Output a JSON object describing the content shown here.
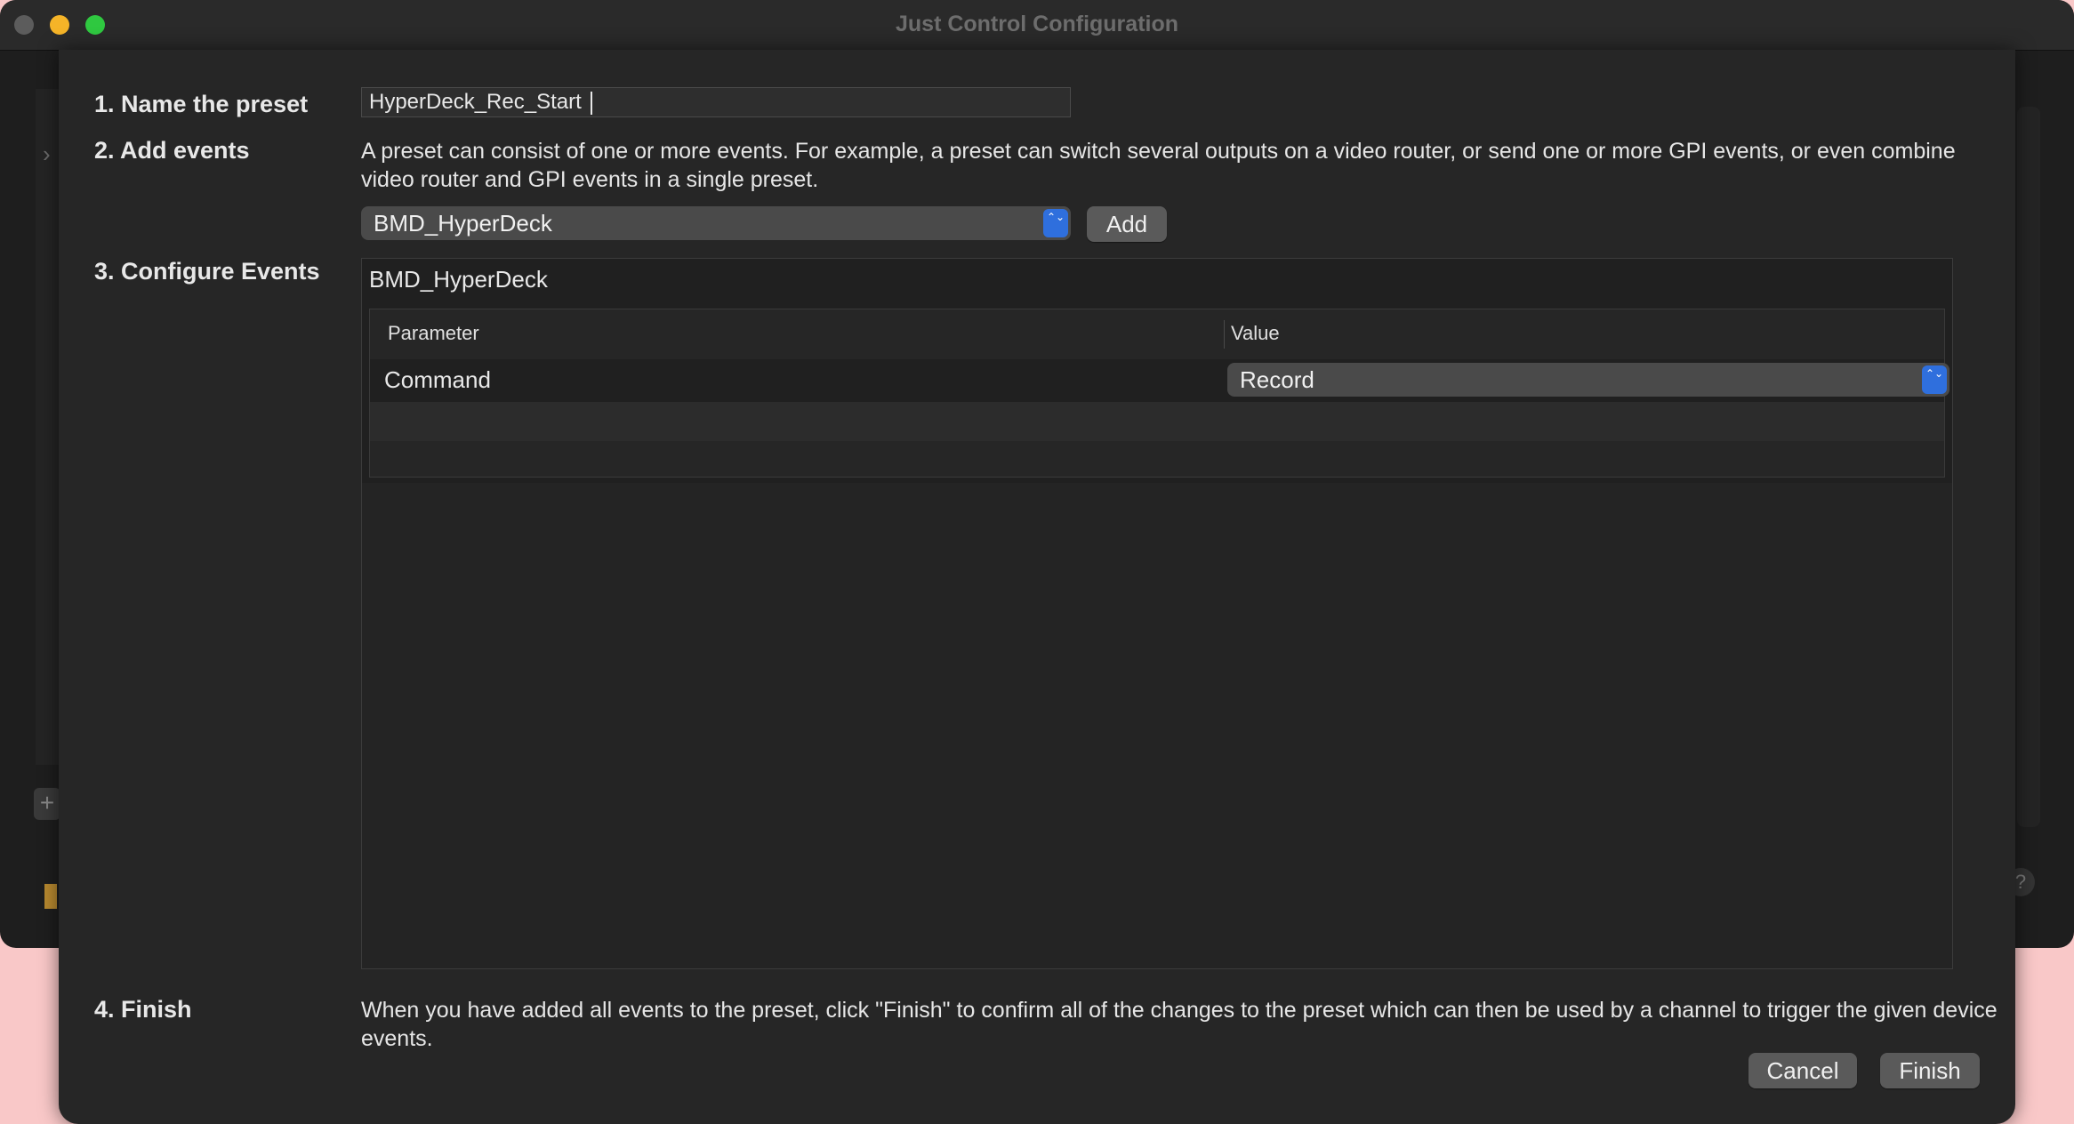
{
  "window": {
    "title": "Just Control Configuration"
  },
  "background": {
    "chevron": "›",
    "plus": "+",
    "help": "?"
  },
  "steps": {
    "name": {
      "label": "1. Name the preset",
      "value": "HyperDeck_Rec_Start",
      "placeholder": ""
    },
    "add": {
      "label": "2. Add events",
      "description": "A preset can consist of one or more events. For example, a preset can switch several outputs on a video router, or send one or more GPI events, or even combine video router and GPI events in a single preset.",
      "device_select": "BMD_HyperDeck",
      "add_button": "Add"
    },
    "configure": {
      "label": "3. Configure Events",
      "event_title": "BMD_HyperDeck",
      "columns": {
        "parameter": "Parameter",
        "value": "Value"
      },
      "rows": [
        {
          "parameter": "Command",
          "value": "Record"
        }
      ]
    },
    "finish": {
      "label": "4. Finish",
      "description": "When you have added all events to the preset, click \"Finish\" to confirm all of the changes to the preset which can then be used by a channel to trigger the given device events.",
      "cancel_button": "Cancel",
      "finish_button": "Finish"
    }
  },
  "icons": {
    "stepper": "⌃⌄"
  },
  "colors": {
    "accent": "#2f6fdd",
    "close": "#5c5c5c",
    "minimize": "#f5b428",
    "maximize": "#2fc840"
  }
}
